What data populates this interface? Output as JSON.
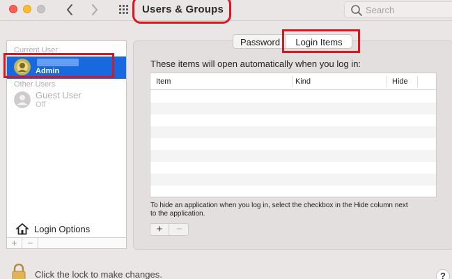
{
  "window": {
    "title": "Users & Groups",
    "search_placeholder": "Search"
  },
  "sidebar": {
    "current_user_label": "Current User",
    "current_user": {
      "role": "Admin"
    },
    "other_users_label": "Other Users",
    "guest": {
      "name": "Guest User",
      "status": "Off"
    },
    "login_options_label": "Login Options",
    "add_label": "+",
    "remove_label": "−"
  },
  "tabs": [
    {
      "label": "Password",
      "selected": false
    },
    {
      "label": "Login Items",
      "selected": true
    }
  ],
  "login_items": {
    "heading": "These items will open automatically when you log in:",
    "columns": [
      "Item",
      "Kind",
      "Hide"
    ],
    "rows": [],
    "help_text": "To hide an application when you log in, select the checkbox in the Hide column next to the application.",
    "add_label": "+",
    "remove_label": "−"
  },
  "footer": {
    "lock_text": "Click the lock to make changes.",
    "help_label": "?"
  },
  "colors": {
    "selection_blue": "#1869e0",
    "highlight_red": "#e0141e",
    "close": "#fe5f57",
    "minimize": "#febc2e"
  },
  "icons": [
    "back-chevron-icon",
    "forward-chevron-icon",
    "grid-icon",
    "search-icon",
    "home-icon",
    "lock-icon",
    "user-avatar-icon",
    "guest-avatar-icon"
  ]
}
